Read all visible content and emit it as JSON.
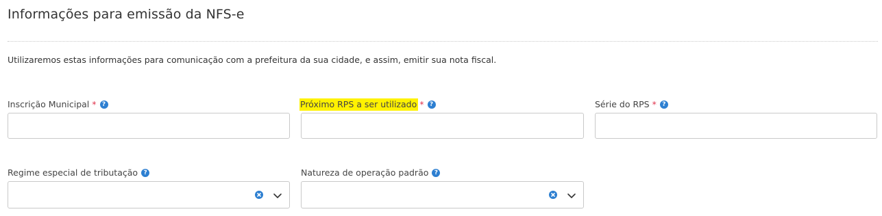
{
  "page": {
    "title": "Informações para emissão da NFS-e",
    "description": "Utilizaremos estas informações para comunicação com a prefeitura da sua cidade, e assim, emitir sua nota fiscal."
  },
  "fields": {
    "inscricao_municipal": {
      "label": "Inscrição Municipal",
      "required_mark": "*",
      "help_glyph": "?",
      "value": ""
    },
    "proximo_rps": {
      "label": "Próximo RPS a ser utilizado",
      "required_mark": "*",
      "help_glyph": "?",
      "value": "",
      "highlight_color": "#fff200"
    },
    "serie_rps": {
      "label": "Série do RPS",
      "required_mark": "*",
      "help_glyph": "?",
      "value": ""
    },
    "regime_especial": {
      "label": "Regime especial de tributação",
      "help_glyph": "?",
      "selected": ""
    },
    "natureza_operacao": {
      "label": "Natureza de operação padrão",
      "help_glyph": "?",
      "selected": ""
    }
  },
  "icons": {
    "help": "question-circle-icon",
    "clear": "clear-circle-x-icon",
    "dropdown": "chevron-down-icon"
  },
  "colors": {
    "accent": "#2d7fd1",
    "required": "#e0334c",
    "highlight": "#fff200",
    "input_border": "#c9c9c9"
  }
}
